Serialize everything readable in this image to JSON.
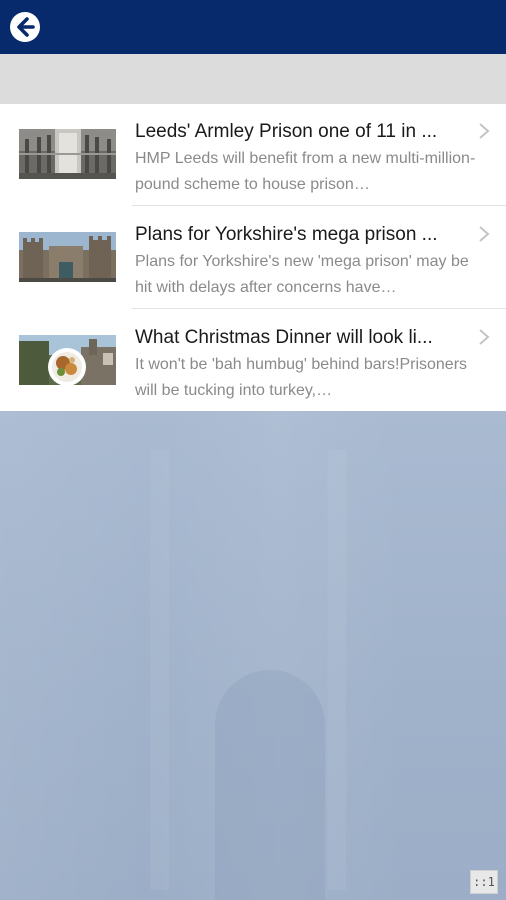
{
  "header": {
    "back_icon": "arrow-left-circle-icon",
    "brand_color": "#062a6b"
  },
  "articles": [
    {
      "title": "Leeds' Armley Prison one of 11 in ...",
      "description": "HMP Leeds will benefit from a new multi-million-pound scheme to house prison…",
      "thumbnail": "prison-interior-photo"
    },
    {
      "title": "Plans for Yorkshire's mega prison ...",
      "description": "Plans for Yorkshire's new 'mega prison' may be hit with delays after concerns have…",
      "thumbnail": "prison-exterior-photo"
    },
    {
      "title": "What Christmas Dinner will look li...",
      "description": "It won't be 'bah humbug' behind bars!Prisoners will be tucking into turkey,…",
      "thumbnail": "christmas-dinner-photo"
    }
  ],
  "page_indicator": "::1"
}
